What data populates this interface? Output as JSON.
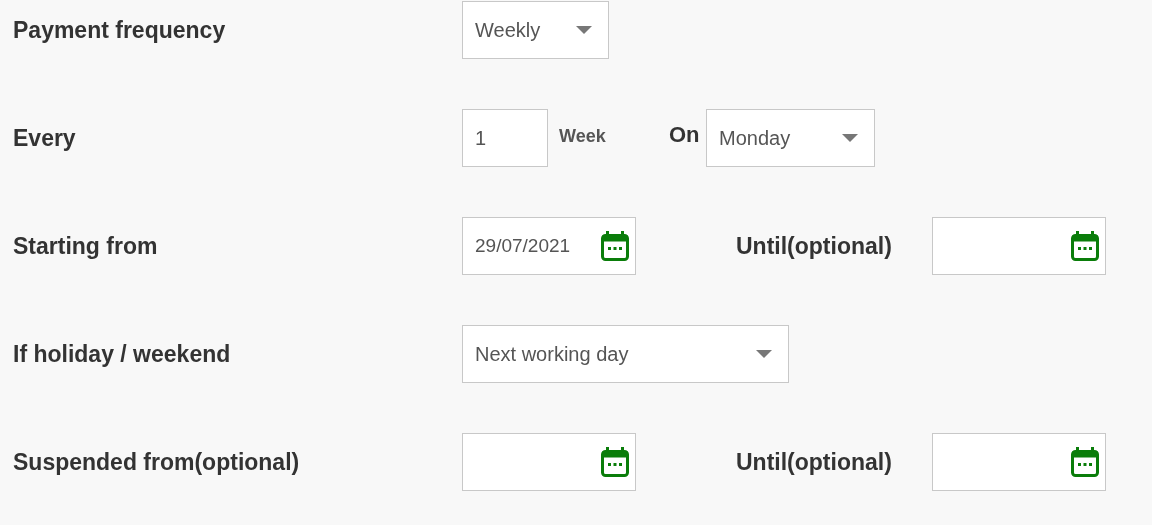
{
  "rows": [
    {
      "kind": "select",
      "label": "Payment frequency",
      "value": "Weekly"
    },
    {
      "kind": "every",
      "label": "Every",
      "value": "1",
      "unit": "Week",
      "on_label": "On",
      "day": "Monday"
    },
    {
      "kind": "range",
      "label": "Starting from",
      "from_value": "29/07/2021",
      "until_label": "Until(optional)"
    },
    {
      "kind": "select",
      "label": "If holiday / weekend",
      "value": "Next working day"
    },
    {
      "kind": "range",
      "label": "Suspended from(optional)",
      "until_label": "Until(optional)"
    }
  ]
}
